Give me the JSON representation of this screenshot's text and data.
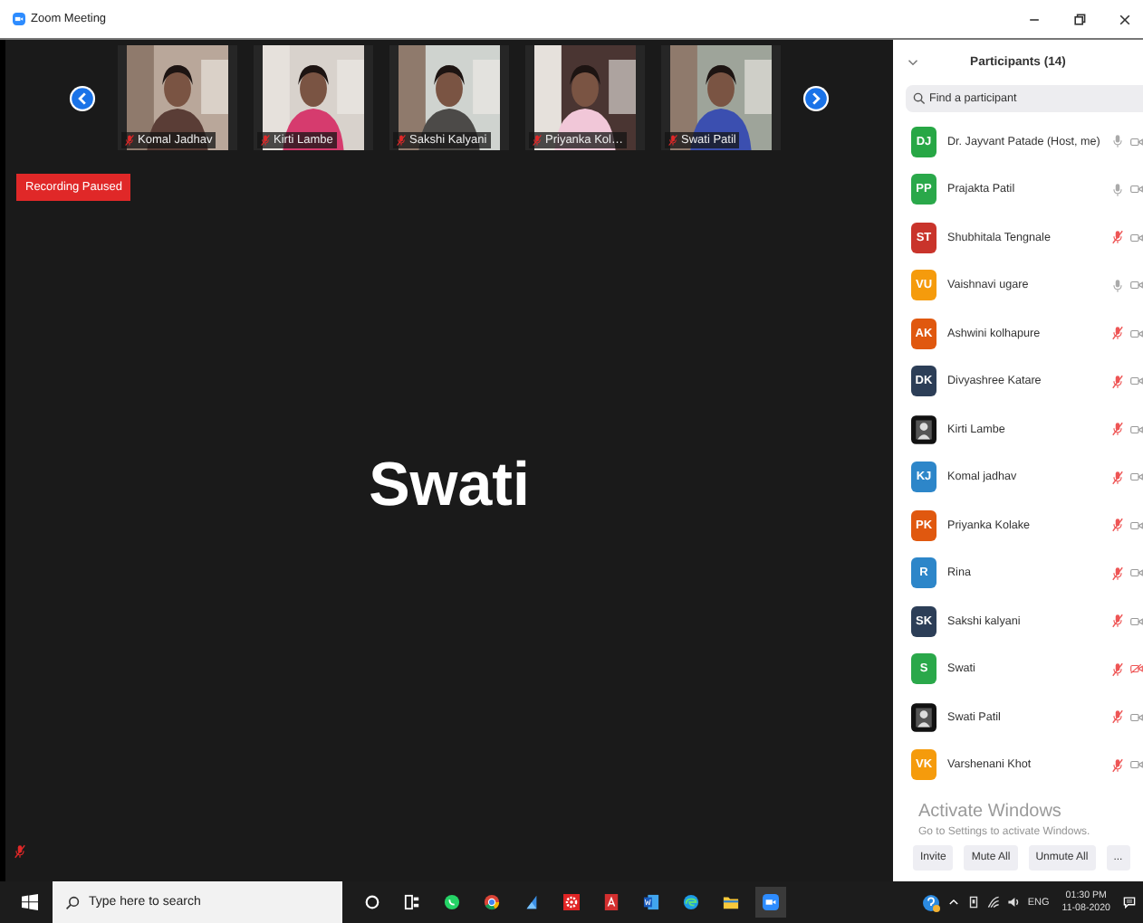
{
  "window": {
    "title": "Zoom Meeting"
  },
  "video_strip": {
    "tiles": [
      {
        "name": "Komal Jadhav",
        "muted": true
      },
      {
        "name": "Kirti Lambe",
        "muted": true
      },
      {
        "name": "Sakshi Kalyani",
        "muted": true
      },
      {
        "name": "Priyanka Kol…",
        "muted": true
      },
      {
        "name": "Swati Patil",
        "muted": true
      }
    ]
  },
  "recording_badge": "Recording Paused",
  "active_speaker": {
    "name": "Swati",
    "muted": true
  },
  "participants_panel": {
    "title": "Participants (14)",
    "search": {
      "placeholder": "Find a participant"
    },
    "participants": [
      {
        "name": "Dr. Jayvant Patade (Host, me)",
        "kind": "initials",
        "initials": "DJ",
        "color": "#27a745",
        "muted": false,
        "video_muted": false
      },
      {
        "name": "Prajakta Patil",
        "kind": "initials",
        "initials": "PP",
        "color": "#2aa84a",
        "muted": false,
        "video_muted": false
      },
      {
        "name": "Shubhitala Tengnale",
        "kind": "initials",
        "initials": "ST",
        "color": "#c9342b",
        "muted": true,
        "video_muted": false
      },
      {
        "name": "Vaishnavi ugare",
        "kind": "initials",
        "initials": "VU",
        "color": "#f59b0c",
        "muted": false,
        "video_muted": false
      },
      {
        "name": "Ashwini kolhapure",
        "kind": "initials",
        "initials": "AK",
        "color": "#e0580f",
        "muted": true,
        "video_muted": false
      },
      {
        "name": "Divyashree Katare",
        "kind": "initials",
        "initials": "DK",
        "color": "#2c3e57",
        "muted": true,
        "video_muted": false
      },
      {
        "name": "Kirti Lambe",
        "kind": "picture",
        "muted": true,
        "video_muted": false
      },
      {
        "name": "Komal  jadhav",
        "kind": "initials",
        "initials": "KJ",
        "color": "#2d86c9",
        "muted": true,
        "video_muted": false
      },
      {
        "name": "Priyanka Kolake",
        "kind": "initials",
        "initials": "PK",
        "color": "#e0580f",
        "muted": true,
        "video_muted": false
      },
      {
        "name": "Rina",
        "kind": "initials",
        "initials": "R",
        "color": "#2d86c9",
        "muted": true,
        "video_muted": false
      },
      {
        "name": "Sakshi kalyani",
        "kind": "initials",
        "initials": "SK",
        "color": "#2c3e57",
        "muted": true,
        "video_muted": false
      },
      {
        "name": "Swati",
        "kind": "initials",
        "initials": "S",
        "color": "#2aa84a",
        "muted": true,
        "video_muted": true
      },
      {
        "name": "Swati Patil",
        "kind": "picture",
        "muted": true,
        "video_muted": false
      },
      {
        "name": "Varshenani Khot",
        "kind": "initials",
        "initials": "VK",
        "color": "#f59b0c",
        "muted": true,
        "video_muted": false
      }
    ],
    "buttons": [
      "Invite",
      "Mute All",
      "Unmute All",
      "..."
    ]
  },
  "system_notice": {
    "title": "Activate Windows",
    "subtitle": "Go to Settings to activate Windows."
  },
  "taskbar": {
    "search": {
      "placeholder": "Type here to search"
    },
    "language": "ENG",
    "time": "01:30 PM",
    "date": "11-08-2020"
  }
}
